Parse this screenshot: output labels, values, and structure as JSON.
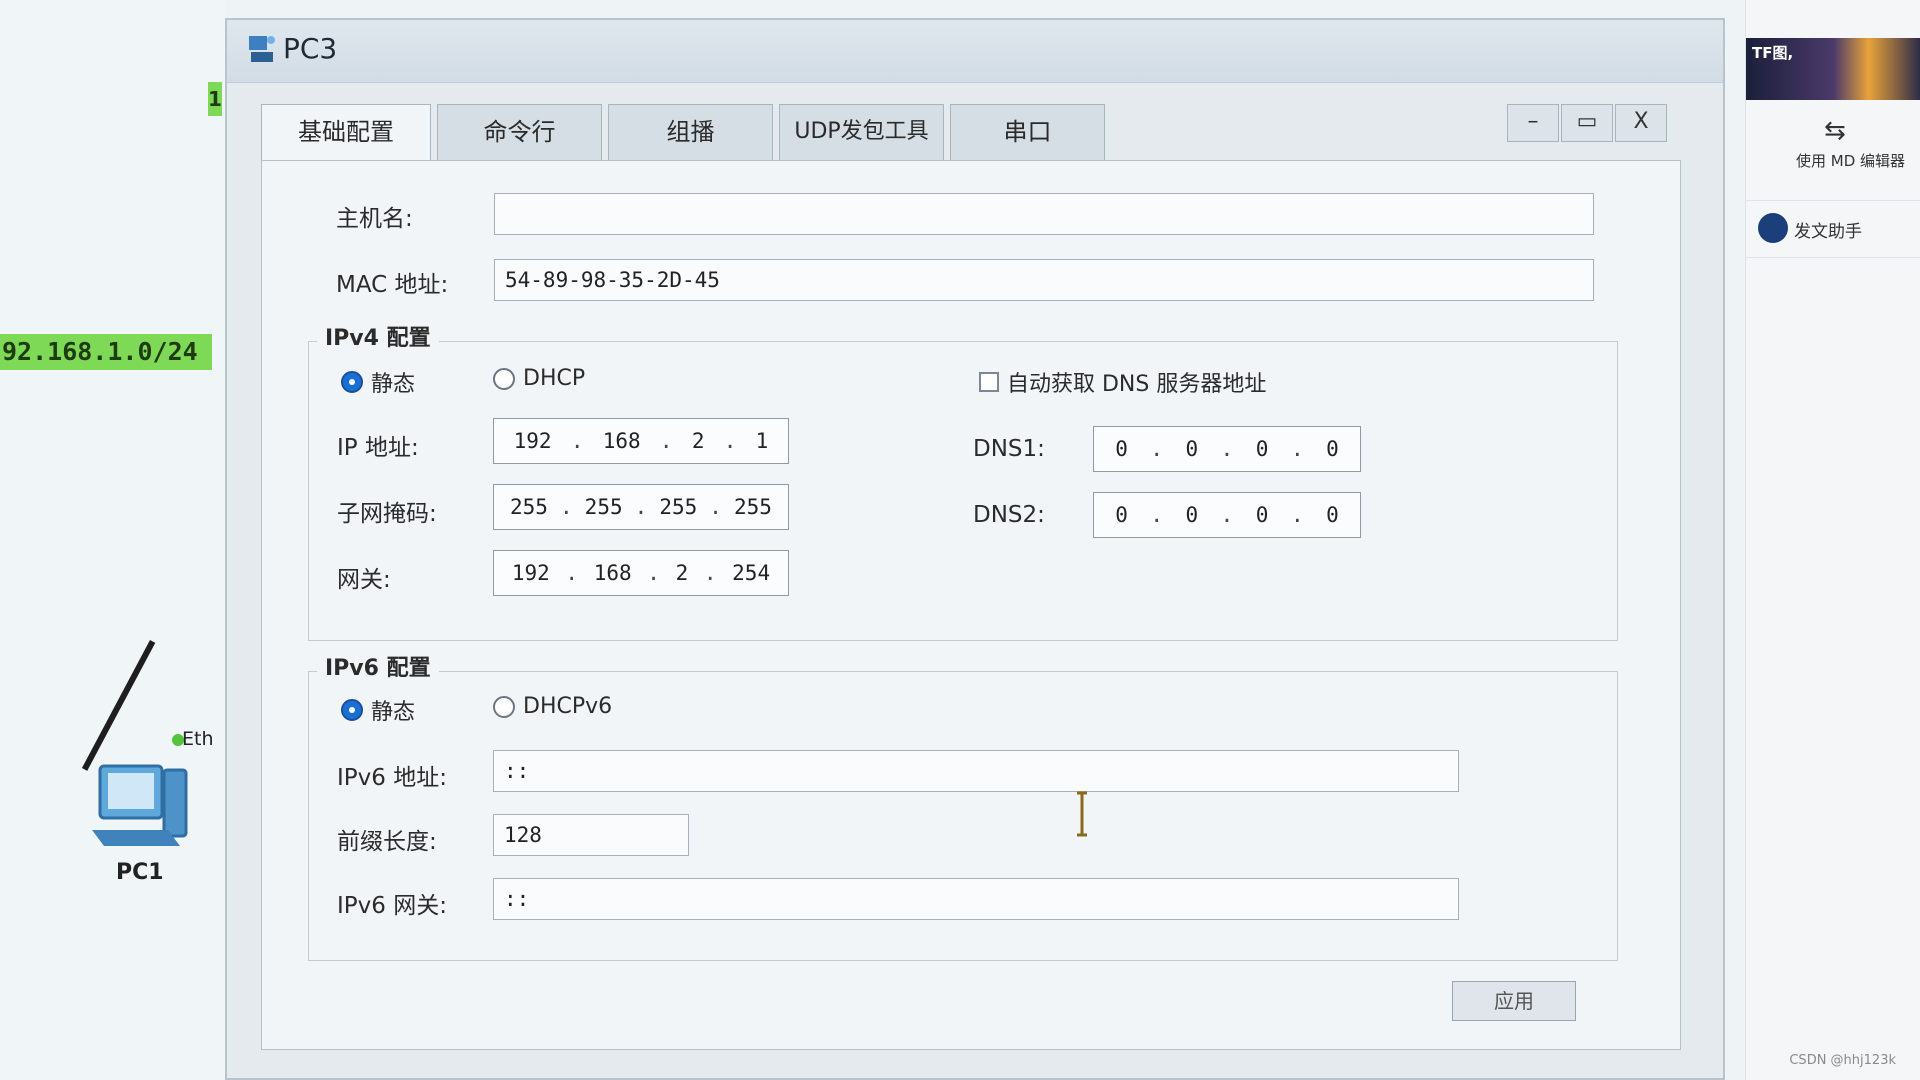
{
  "background": {
    "network_label": "92.168.1.0/24",
    "network_tag": "1",
    "eth_label": "Eth",
    "pc_label": "PC1"
  },
  "right_panel": {
    "banner_text": "TF图,",
    "md_editor": "使用 MD 编辑器",
    "helper": "发文助手",
    "watermark": "CSDN @hhj123k"
  },
  "window": {
    "title": "PC3",
    "controls": {
      "minimize": "–",
      "maximize": "▭",
      "close": "X"
    },
    "tabs": [
      {
        "label": "基础配置",
        "active": true
      },
      {
        "label": "命令行",
        "active": false
      },
      {
        "label": "组播",
        "active": false
      },
      {
        "label": "UDP发包工具",
        "active": false
      },
      {
        "label": "串口",
        "active": false
      }
    ]
  },
  "basic": {
    "hostname_label": "主机名:",
    "hostname_value": "",
    "mac_label": "MAC 地址:",
    "mac_value": "54-89-98-35-2D-45"
  },
  "ipv4": {
    "group_title": "IPv4 配置",
    "static_label": "静态",
    "dhcp_label": "DHCP",
    "auto_dns_label": "自动获取 DNS 服务器地址",
    "ip_label": "IP 地址:",
    "ip": [
      "192",
      "168",
      "2",
      "1"
    ],
    "mask_label": "子网掩码:",
    "mask": [
      "255",
      "255",
      "255",
      "255"
    ],
    "gateway_label": "网关:",
    "gateway": [
      "192",
      "168",
      "2",
      "254"
    ],
    "dns1_label": "DNS1:",
    "dns1": [
      "0",
      "0",
      "0",
      "0"
    ],
    "dns2_label": "DNS2:",
    "dns2": [
      "0",
      "0",
      "0",
      "0"
    ]
  },
  "ipv6": {
    "group_title": "IPv6 配置",
    "static_label": "静态",
    "dhcp_label": "DHCPv6",
    "addr_label": "IPv6 地址:",
    "addr_value": "::",
    "prefix_label": "前缀长度:",
    "prefix_value": "128",
    "gateway_label": "IPv6 网关:",
    "gateway_value": "::"
  },
  "apply_label": "应用",
  "colors": {
    "accent": "#1a6fd6",
    "network_green": "#7ed957"
  }
}
